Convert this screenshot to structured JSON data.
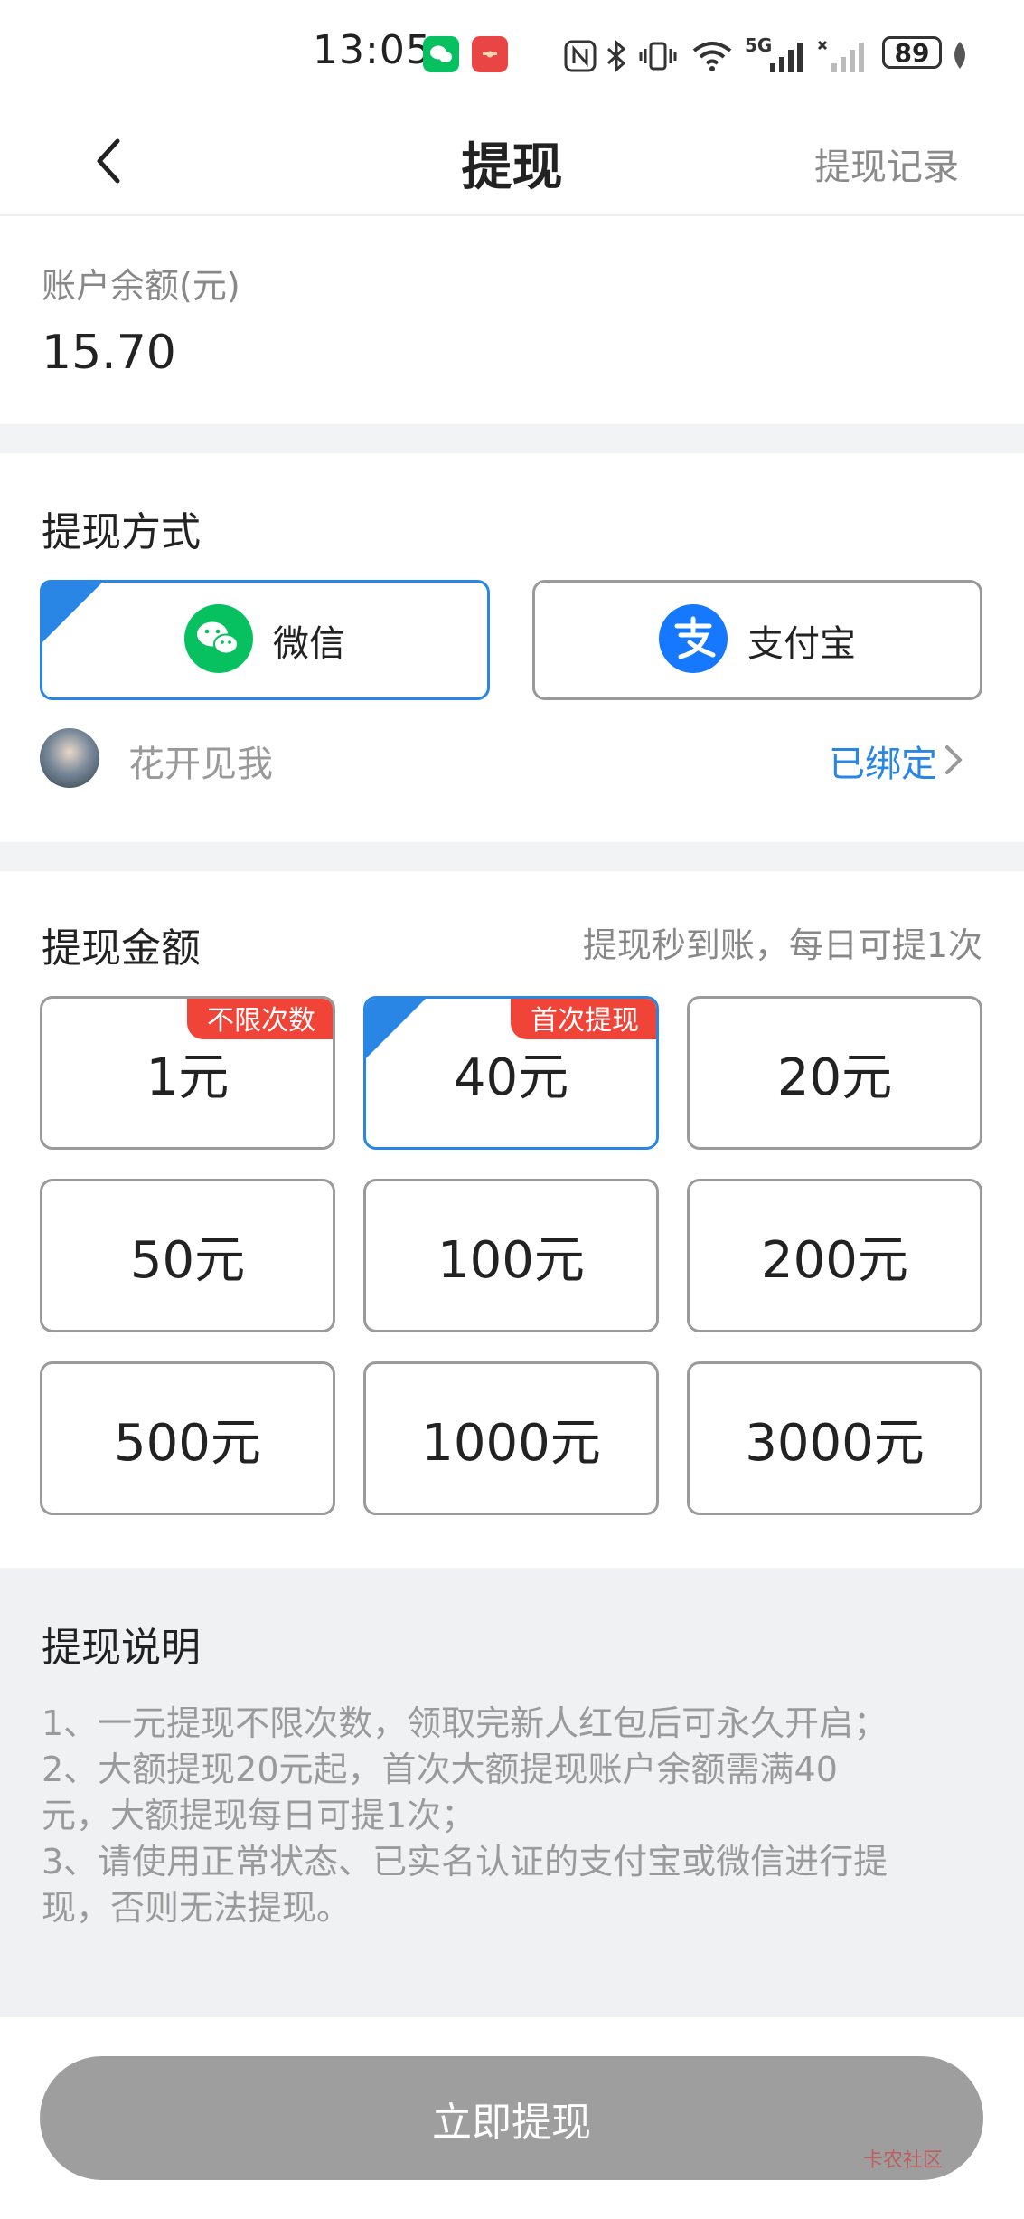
{
  "status_bar": {
    "time": "13:05",
    "battery": "89",
    "network": "5G"
  },
  "nav": {
    "title": "提现",
    "right_link": "提现记录"
  },
  "balance": {
    "label": "账户余额(元)",
    "value": "15.70"
  },
  "method": {
    "title": "提现方式",
    "options": [
      {
        "label": "微信",
        "selected": true
      },
      {
        "label": "支付宝",
        "selected": false
      }
    ],
    "account": {
      "nickname": "花开见我",
      "bound_label": "已绑定"
    }
  },
  "amount": {
    "title": "提现金额",
    "hint": "提现秒到账，每日可提1次",
    "options": [
      {
        "label": "1元",
        "tag": "不限次数",
        "selected": false
      },
      {
        "label": "40元",
        "tag": "首次提现",
        "selected": true
      },
      {
        "label": "20元",
        "tag": "",
        "selected": false
      },
      {
        "label": "50元",
        "tag": "",
        "selected": false
      },
      {
        "label": "100元",
        "tag": "",
        "selected": false
      },
      {
        "label": "200元",
        "tag": "",
        "selected": false
      },
      {
        "label": "500元",
        "tag": "",
        "selected": false
      },
      {
        "label": "1000元",
        "tag": "",
        "selected": false
      },
      {
        "label": "3000元",
        "tag": "",
        "selected": false
      }
    ]
  },
  "explanation": {
    "title": "提现说明",
    "lines": [
      "1、一元提现不限次数，领取完新人红包后可永久开启；",
      "2、大额提现20元起，首次大额提现账户余额需满40",
      "元，大额提现每日可提1次；",
      "3、请使用正常状态、已实名认证的支付宝或微信进行提",
      "现，否则无法提现。"
    ]
  },
  "submit": {
    "label": "立即提现"
  },
  "watermark": "卡农社区",
  "colors": {
    "accent": "#2a86e4",
    "tag": "#f04438",
    "wechat": "#07c160",
    "alipay": "#1677ff",
    "button_disabled": "#9e9e9e"
  }
}
